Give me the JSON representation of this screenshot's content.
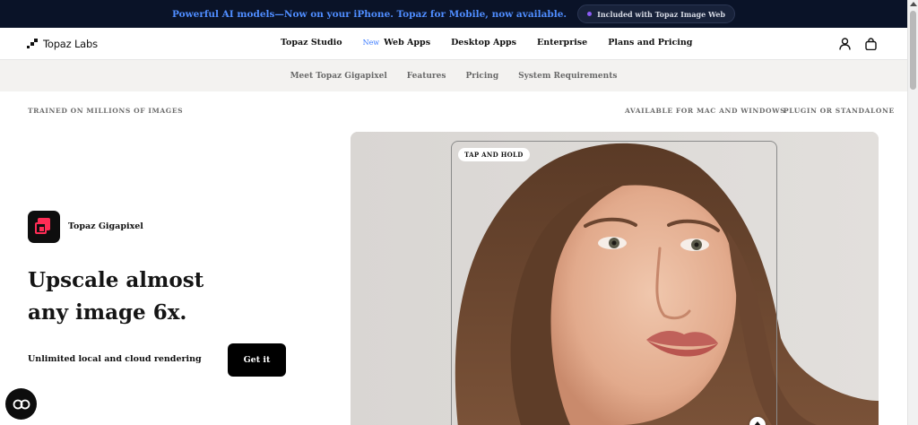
{
  "announcement": {
    "text": "Powerful AI models—Now on your iPhone. Topaz for Mobile, now available.",
    "pill": "Included with Topaz Image Web"
  },
  "header": {
    "logo_text": "Topaz Labs",
    "nav": [
      {
        "label": "Topaz Studio"
      },
      {
        "label": "Web Apps",
        "badge": "New"
      },
      {
        "label": "Desktop Apps"
      },
      {
        "label": "Enterprise"
      },
      {
        "label": "Plans and Pricing"
      }
    ],
    "icons": [
      "user-icon",
      "shopping-bag-icon"
    ]
  },
  "subnav": [
    "Meet Topaz Gigapixel",
    "Features",
    "Pricing",
    "System Requirements"
  ],
  "tags": {
    "left": "TRAINED ON MILLIONS OF IMAGES",
    "mid": "AVAILABLE FOR MAC AND WINDOWS",
    "right": "PLUGIN OR STANDALONE"
  },
  "product": {
    "name": "Topaz Gigapixel",
    "headline_line1": "Upscale almost",
    "headline_line2": "any image 6x.",
    "subtext": "Unlimited local and cloud rendering",
    "cta": "Get it"
  },
  "hero": {
    "badge": "TAP AND HOLD"
  },
  "colors": {
    "announce_bg": "#0a1328",
    "announce_text": "#4f8dff",
    "brand_red": "#ff2c55",
    "subnav_bg": "#f3f2f0"
  }
}
